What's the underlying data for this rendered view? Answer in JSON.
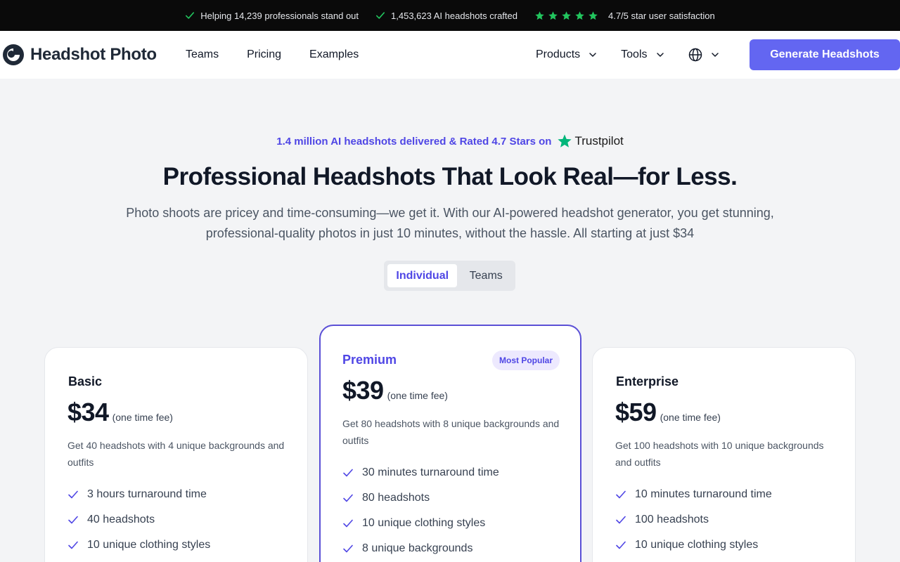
{
  "topbar": {
    "items": [
      "Helping 14,239 professionals stand out",
      "1,453,623 AI headshots crafted",
      "4.7/5 star user satisfaction"
    ],
    "accent": "#22c55e"
  },
  "nav": {
    "brand": "Headshot Photo",
    "links": [
      "Teams",
      "Pricing",
      "Examples"
    ],
    "products": "Products",
    "tools": "Tools",
    "cta": "Generate Headshots"
  },
  "hero": {
    "rated": "1.4 million AI headshots delivered & Rated 4.7 Stars on",
    "trustpilot": "Trustpilot",
    "title": "Professional Headshots That Look Real—for Less.",
    "subtitle": "Photo shoots are pricey and time-consuming—we get it. With our AI-powered headshot generator, you get stunning, professional-quality photos in just 10 minutes, without the hassle. All starting at just $34"
  },
  "toggle": {
    "individual": "Individual",
    "teams": "Teams",
    "selected": "Individual"
  },
  "plans": [
    {
      "name": "Basic",
      "price": "$34",
      "fee": "(one time fee)",
      "description": "Get 40 headshots with 4 unique backgrounds and outfits",
      "features": [
        "3 hours turnaround time",
        "40 headshots",
        "10 unique clothing styles"
      ]
    },
    {
      "name": "Premium",
      "badge": "Most Popular",
      "price": "$39",
      "fee": "(one time fee)",
      "description": "Get 80 headshots with 8 unique backgrounds and outfits",
      "features": [
        "30 minutes turnaround time",
        "80 headshots",
        "10 unique clothing styles",
        "8 unique backgrounds"
      ]
    },
    {
      "name": "Enterprise",
      "price": "$59",
      "fee": "(one time fee)",
      "description": "Get 100 headshots with 10 unique backgrounds and outfits",
      "features": [
        "10 minutes turnaround time",
        "100 headshots",
        "10 unique clothing styles"
      ]
    }
  ],
  "colors": {
    "brand": "#6366f1",
    "accent_text": "#4f46e5",
    "trustpilot_green": "#00b67a"
  }
}
